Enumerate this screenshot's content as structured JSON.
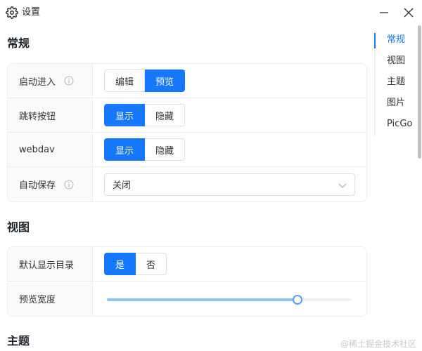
{
  "window": {
    "title": "设置",
    "settings_icon": "gear-icon",
    "minimize_icon": "minimize-icon",
    "close_icon": "close-icon"
  },
  "sections": {
    "general": {
      "title": "常规",
      "rows": [
        {
          "label": "启动进入",
          "has_info": true,
          "control": "segmented",
          "options": [
            "编辑",
            "预览"
          ],
          "selected": "预览"
        },
        {
          "label": "跳转按钮",
          "has_info": false,
          "control": "segmented",
          "options": [
            "显示",
            "隐藏"
          ],
          "selected": "显示"
        },
        {
          "label": "webdav",
          "has_info": false,
          "control": "segmented",
          "options": [
            "显示",
            "隐藏"
          ],
          "selected": "显示"
        },
        {
          "label": "自动保存",
          "has_info": true,
          "control": "select",
          "value": "关闭"
        }
      ]
    },
    "view": {
      "title": "视图",
      "rows": [
        {
          "label": "默认显示目录",
          "control": "segmented",
          "options": [
            "是",
            "否"
          ],
          "selected": "是"
        },
        {
          "label": "预览宽度",
          "control": "slider",
          "value_fraction": 0.78
        }
      ]
    },
    "theme": {
      "title": "主题"
    }
  },
  "toc": {
    "items": [
      "常规",
      "视图",
      "主题",
      "图片",
      "PicGo"
    ],
    "active": "常规"
  },
  "colors": {
    "accent": "#1677ff",
    "slider_fill": "#91c3f5",
    "border": "#dcdfe6"
  },
  "watermark": "@稀土掘金技术社区"
}
